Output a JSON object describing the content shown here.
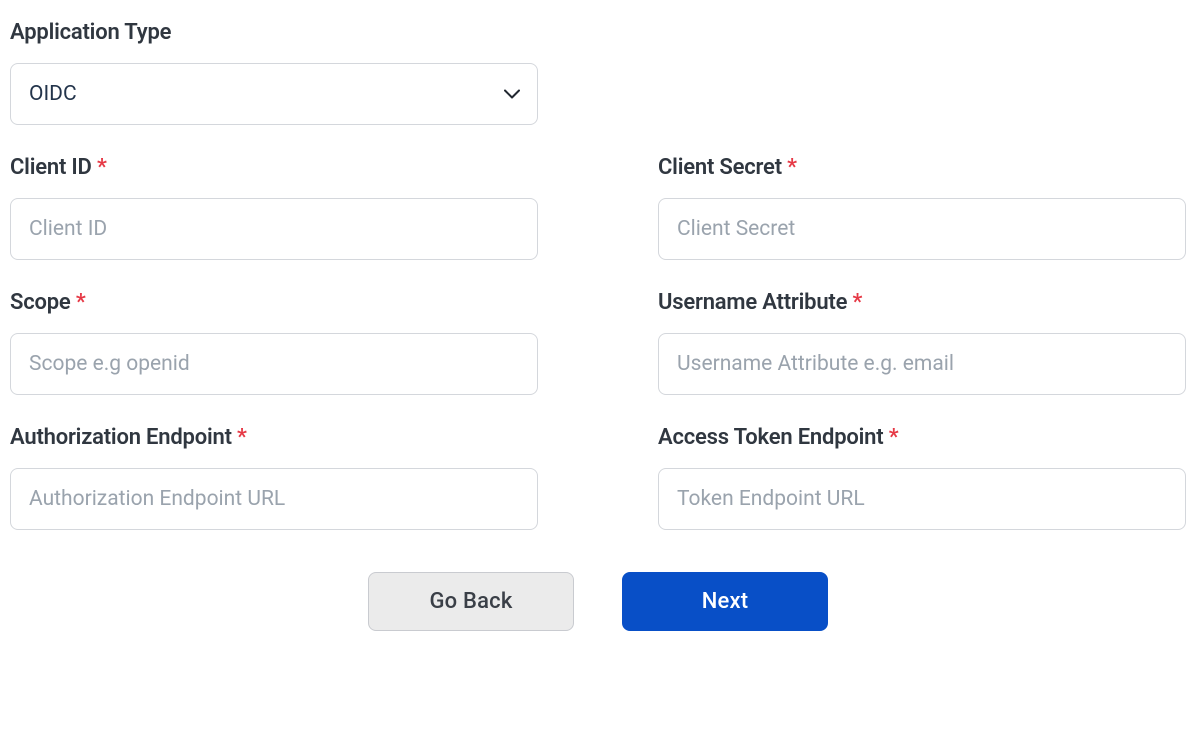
{
  "fields": {
    "applicationType": {
      "label": "Application Type",
      "value": "OIDC"
    },
    "clientId": {
      "label": "Client ID",
      "placeholder": "Client ID",
      "required": "*"
    },
    "clientSecret": {
      "label": "Client Secret",
      "placeholder": "Client Secret",
      "required": "*"
    },
    "scope": {
      "label": "Scope",
      "placeholder": "Scope e.g openid",
      "required": "*"
    },
    "usernameAttribute": {
      "label": "Username Attribute",
      "placeholder": "Username Attribute e.g. email",
      "required": "*"
    },
    "authorizationEndpoint": {
      "label": "Authorization Endpoint",
      "placeholder": "Authorization Endpoint URL",
      "required": "*"
    },
    "accessTokenEndpoint": {
      "label": "Access Token Endpoint",
      "placeholder": "Token Endpoint URL",
      "required": "*"
    }
  },
  "buttons": {
    "goBack": "Go Back",
    "next": "Next"
  }
}
